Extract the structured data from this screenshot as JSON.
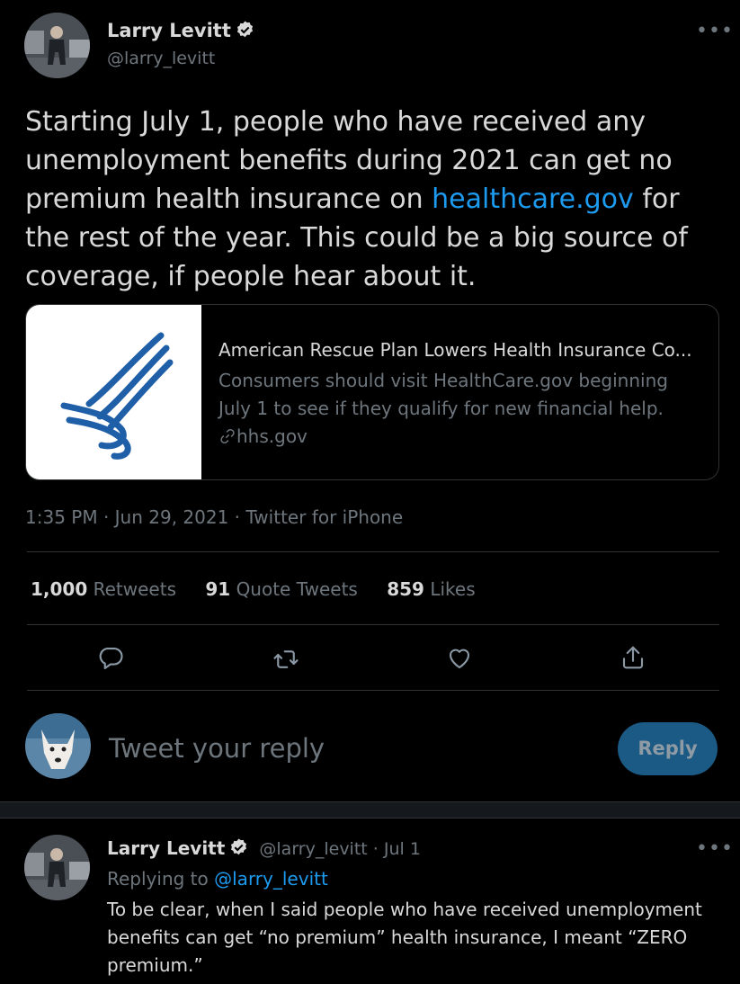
{
  "tweet": {
    "author_name": "Larry Levitt",
    "author_handle": "@larry_levitt",
    "text_before_link": "Starting July 1, people who have received any unemployment benefits during 2021 can get no premium health insurance on ",
    "link_text": "healthcare.gov",
    "text_after_link": " for the rest of the year. This could be a big source of coverage, if people hear about it.",
    "card": {
      "title": "American Rescue Plan Lowers Health Insurance Co...",
      "description": "Consumers should visit HealthCare.gov beginning July 1 to see if they qualify for new financial help.",
      "domain": "hhs.gov"
    },
    "timestamp": "1:35 PM · Jun 29, 2021 · Twitter for iPhone",
    "stats": {
      "retweets_count": "1,000",
      "retweets_label": "Retweets",
      "quotes_count": "91",
      "quotes_label": "Quote Tweets",
      "likes_count": "859",
      "likes_label": "Likes"
    }
  },
  "reply_box": {
    "placeholder": "Tweet your reply",
    "button_label": "Reply"
  },
  "reply_tweet": {
    "author_name": "Larry Levitt",
    "meta": "@larry_levitt · Jul 1",
    "replying_to_prefix": "Replying to ",
    "replying_to_handle": "@larry_levitt",
    "text": "To be clear, when I said people who have received unemployment benefits can get “no premium” health insurance, I meant “ZERO premium.”"
  },
  "colors": {
    "background": "#000000",
    "text": "#d9d9d9",
    "muted": "#6e767d",
    "link": "#1d9bf0",
    "reply_button": "#1a5a85"
  },
  "icons": [
    "verified-badge-icon",
    "more-options-icon",
    "reply-icon",
    "retweet-icon",
    "like-icon",
    "share-icon",
    "link-icon",
    "hhs-eagle-logo"
  ]
}
